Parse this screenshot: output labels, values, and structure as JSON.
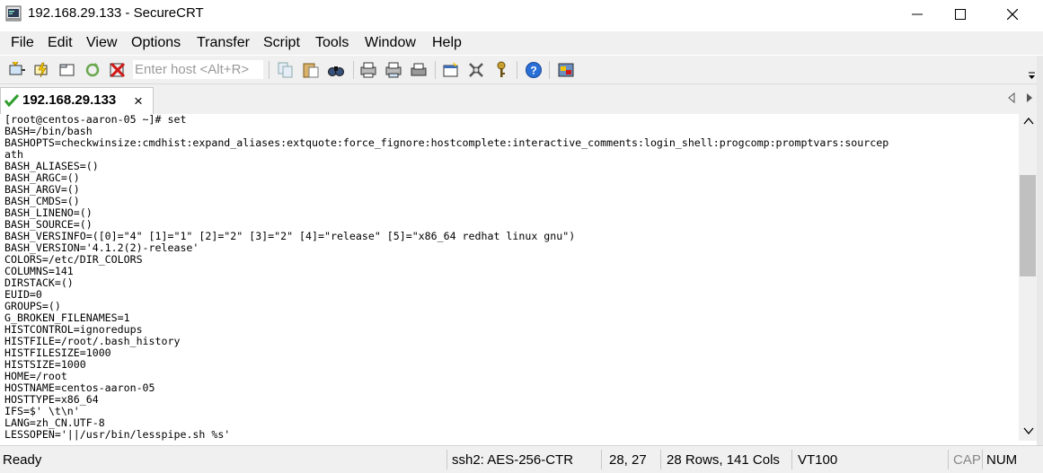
{
  "window": {
    "title": "192.168.29.133 - SecureCRT",
    "minimize_label": "minimize",
    "maximize_label": "maximize",
    "close_label": "close"
  },
  "menu": {
    "items": [
      "File",
      "Edit",
      "View",
      "Options",
      "Transfer",
      "Script",
      "Tools",
      "Window",
      "Help"
    ]
  },
  "toolbar": {
    "host_placeholder": "Enter host <Alt+R>",
    "icons": [
      "connect-icon",
      "quick-connect-icon",
      "connect-in-tab-icon",
      "reconnect-icon",
      "disconnect-icon",
      "copy-icon",
      "paste-icon",
      "find-icon",
      "print-screen-icon",
      "print-selection-icon",
      "print-icon",
      "session-options-icon",
      "global-options-icon",
      "keymap-icon",
      "help-icon",
      "sftp-icon"
    ]
  },
  "tab": {
    "label": "192.168.29.133",
    "status": "connected",
    "close_glyph": "×"
  },
  "terminal": {
    "lines": [
      "[root@centos-aaron-05 ~]# set",
      "BASH=/bin/bash",
      "BASHOPTS=checkwinsize:cmdhist:expand_aliases:extquote:force_fignore:hostcomplete:interactive_comments:login_shell:progcomp:promptvars:sourcep",
      "ath",
      "BASH_ALIASES=()",
      "BASH_ARGC=()",
      "BASH_ARGV=()",
      "BASH_CMDS=()",
      "BASH_LINENO=()",
      "BASH_SOURCE=()",
      "BASH_VERSINFO=([0]=\"4\" [1]=\"1\" [2]=\"2\" [3]=\"2\" [4]=\"release\" [5]=\"x86_64 redhat linux gnu\")",
      "BASH_VERSION='4.1.2(2)-release'",
      "COLORS=/etc/DIR_COLORS",
      "COLUMNS=141",
      "DIRSTACK=()",
      "EUID=0",
      "GROUPS=()",
      "G_BROKEN_FILENAMES=1",
      "HISTCONTROL=ignoredups",
      "HISTFILE=/root/.bash_history",
      "HISTFILESIZE=1000",
      "HISTSIZE=1000",
      "HOME=/root",
      "HOSTNAME=centos-aaron-05",
      "HOSTTYPE=x86_64",
      "IFS=$' \\t\\n'",
      "LANG=zh_CN.UTF-8",
      "LESSOPEN='||/usr/bin/lesspipe.sh %s'"
    ]
  },
  "status": {
    "ready": "Ready",
    "cipher": "ssh2: AES-256-CTR",
    "cursor": "28,  27",
    "size": "28 Rows, 141 Cols",
    "emulation": "VT100",
    "caps": "CAP",
    "num": "NUM"
  },
  "colors": {
    "chrome": "#f0f0f0",
    "terminal_bg": "#ffffff",
    "terminal_fg": "#000000",
    "check_green": "#2e9e2e",
    "disconnect_red": "#d01818",
    "help_blue": "#2a6fd6"
  }
}
